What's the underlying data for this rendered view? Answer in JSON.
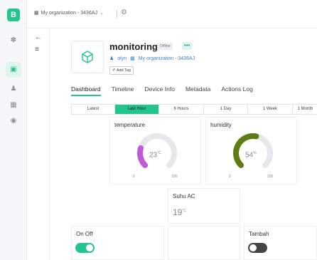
{
  "rail": {
    "logo": "B",
    "items": [
      "globe",
      "layers",
      "person",
      "building",
      "lightbulb"
    ]
  },
  "topbar": {
    "org": "My organization - 3436AJ"
  },
  "device": {
    "name": "monitoring",
    "status": "Offline",
    "more": "•••",
    "owner": "olyn",
    "org": "My organization - 3436AJ",
    "add_tag": "Add Tag"
  },
  "tabs": [
    "Dashboard",
    "Timeline",
    "Device Info",
    "Metadata",
    "Actions Log"
  ],
  "ranges": [
    "Latest",
    "Last Hour",
    "6 Hours",
    "1 Day",
    "1 Week",
    "1 Month"
  ],
  "widgets": {
    "temperature": {
      "title": "temperature",
      "value": "23",
      "unit": "°C",
      "min": "0",
      "max": "100",
      "fraction": 0.23,
      "color": "#c05bd6"
    },
    "humidity": {
      "title": "humidity",
      "value": "54",
      "unit": "%",
      "min": "0",
      "max": "100",
      "fraction": 0.54,
      "color": "#5d7d12"
    },
    "suhu": {
      "title": "Suhu AC",
      "value": "19",
      "unit": "°C"
    },
    "onoff": {
      "title": "On Off",
      "state": "on",
      "color": "#23c48e"
    },
    "tambah": {
      "title": "Tambah",
      "state": "off",
      "color": "#444444"
    }
  }
}
